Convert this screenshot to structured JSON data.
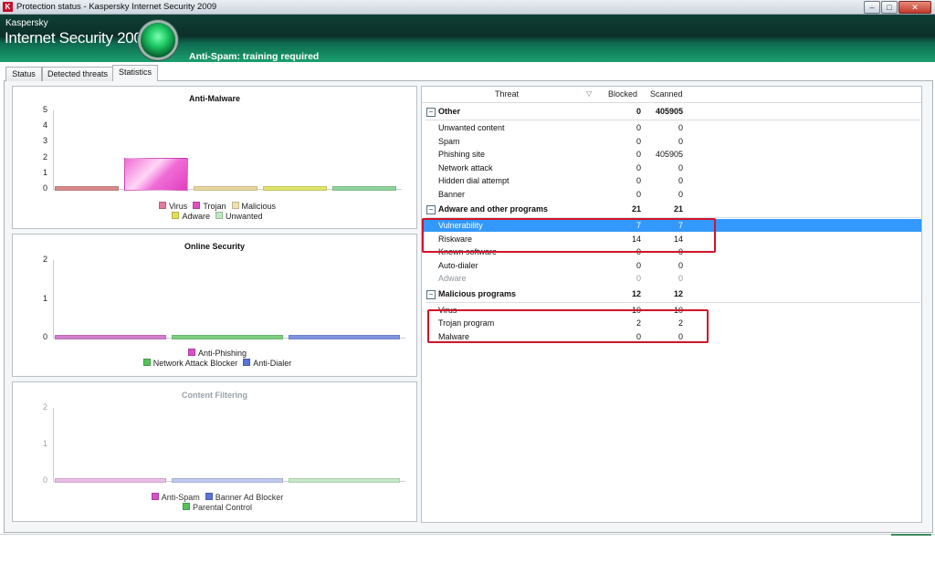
{
  "window": {
    "title": "Protection status - Kaspersky Internet Security 2009",
    "app_icon": "kaspersky-k-icon",
    "controls": [
      "minimize-icon",
      "maximize-icon",
      "close-icon"
    ]
  },
  "header": {
    "brand_line1": "Kaspersky",
    "brand_line2": "Internet Security 2009",
    "status_text": "Anti-Spam: training required",
    "status_indicator_color": "#1ecb66"
  },
  "tabs": [
    {
      "label": "Status"
    },
    {
      "label": "Detected threats"
    },
    {
      "label": "Statistics",
      "active": true
    }
  ],
  "charts": [
    {
      "title": "Anti-Malware",
      "type": "bar",
      "yticks": [
        "5",
        "4",
        "3",
        "2",
        "1",
        "0"
      ],
      "ylim": [
        0,
        5
      ],
      "bars": [
        {
          "name": "Virus",
          "value": 0,
          "color": "#d88a8a"
        },
        {
          "name": "Trojan",
          "value": 2,
          "color": "#f06cd6"
        },
        {
          "name": "Malicious",
          "value": 0,
          "color": "#e8d6a0"
        },
        {
          "name": "Adware",
          "value": 0,
          "color": "#dfe36a"
        },
        {
          "name": "Unwanted",
          "value": 0,
          "color": "#8fd39a"
        }
      ],
      "legend_rows": [
        [
          "Virus",
          "Trojan",
          "Malicious"
        ],
        [
          "Adware",
          "Unwanted"
        ]
      ],
      "legend_colors": {
        "Virus": "#e07a9a",
        "Trojan": "#e04fc0",
        "Malicious": "#f0e2b0",
        "Adware": "#e3dd55",
        "Unwanted": "#bde8c2"
      }
    },
    {
      "title": "Online Security",
      "type": "bar",
      "yticks": [
        "2",
        "1",
        "0"
      ],
      "ylim": [
        0,
        2
      ],
      "bars": [
        {
          "name": "Anti-Phishing",
          "value": 0,
          "color": "#d27fd0"
        },
        {
          "name": "Network Attack Blocker",
          "value": 0,
          "color": "#7ccf7f"
        },
        {
          "name": "Anti-Dialer",
          "value": 0,
          "color": "#7f93e0"
        }
      ],
      "legend_rows": [
        [
          "Anti-Phishing"
        ],
        [
          "Network Attack Blocker",
          "Anti-Dialer"
        ]
      ],
      "legend_colors": {
        "Anti-Phishing": "#d84fc8",
        "Network Attack Blocker": "#55c25a",
        "Anti-Dialer": "#5b72d8"
      }
    },
    {
      "title": "Content Filtering",
      "type": "bar",
      "dimmed": true,
      "yticks": [
        "2",
        "1",
        "0"
      ],
      "ylim": [
        0,
        2
      ],
      "bars": [
        {
          "name": "Anti-Spam",
          "value": 0,
          "color": "#ebbde6"
        },
        {
          "name": "Banner Ad Blocker",
          "value": 0,
          "color": "#c0c9ef"
        },
        {
          "name": "Parental Control",
          "value": 0,
          "color": "#c5e9c7"
        }
      ],
      "legend_rows": [
        [
          "Anti-Spam",
          "Banner Ad Blocker"
        ],
        [
          "Parental Control"
        ]
      ],
      "legend_colors": {
        "Anti-Spam": "#d84fc8",
        "Banner Ad Blocker": "#5b72d8",
        "Parental Control": "#55c25a"
      }
    }
  ],
  "table": {
    "columns": {
      "threat": "Threat",
      "blocked": "Blocked",
      "scanned": "Scanned"
    },
    "sort_icon": "sort-descending-icon",
    "groups": [
      {
        "name": "Other",
        "blocked": "0",
        "scanned": "405905",
        "rows": [
          {
            "name": "Unwanted content",
            "blocked": "0",
            "scanned": "0"
          },
          {
            "name": "Spam",
            "blocked": "0",
            "scanned": "0"
          },
          {
            "name": "Phishing site",
            "blocked": "0",
            "scanned": "405905"
          },
          {
            "name": "Network attack",
            "blocked": "0",
            "scanned": "0"
          },
          {
            "name": "Hidden dial attempt",
            "blocked": "0",
            "scanned": "0"
          },
          {
            "name": "Banner",
            "blocked": "0",
            "scanned": "0"
          }
        ]
      },
      {
        "name": "Adware and other programs",
        "blocked": "21",
        "scanned": "21",
        "rows": [
          {
            "name": "Vulnerability",
            "blocked": "7",
            "scanned": "7",
            "selected": true
          },
          {
            "name": "Riskware",
            "blocked": "14",
            "scanned": "14"
          },
          {
            "name": "Known software",
            "blocked": "0",
            "scanned": "0"
          },
          {
            "name": "Auto-dialer",
            "blocked": "0",
            "scanned": "0"
          },
          {
            "name": "Adware",
            "blocked": "0",
            "scanned": "0",
            "faded": true
          }
        ]
      },
      {
        "name": "Malicious programs",
        "blocked": "12",
        "scanned": "12",
        "rows": [
          {
            "name": "Virus",
            "blocked": "10",
            "scanned": "10"
          },
          {
            "name": "Trojan program",
            "blocked": "2",
            "scanned": "2"
          },
          {
            "name": "Malware",
            "blocked": "0",
            "scanned": "0"
          }
        ]
      }
    ]
  },
  "annotation_color": "#d0142a"
}
